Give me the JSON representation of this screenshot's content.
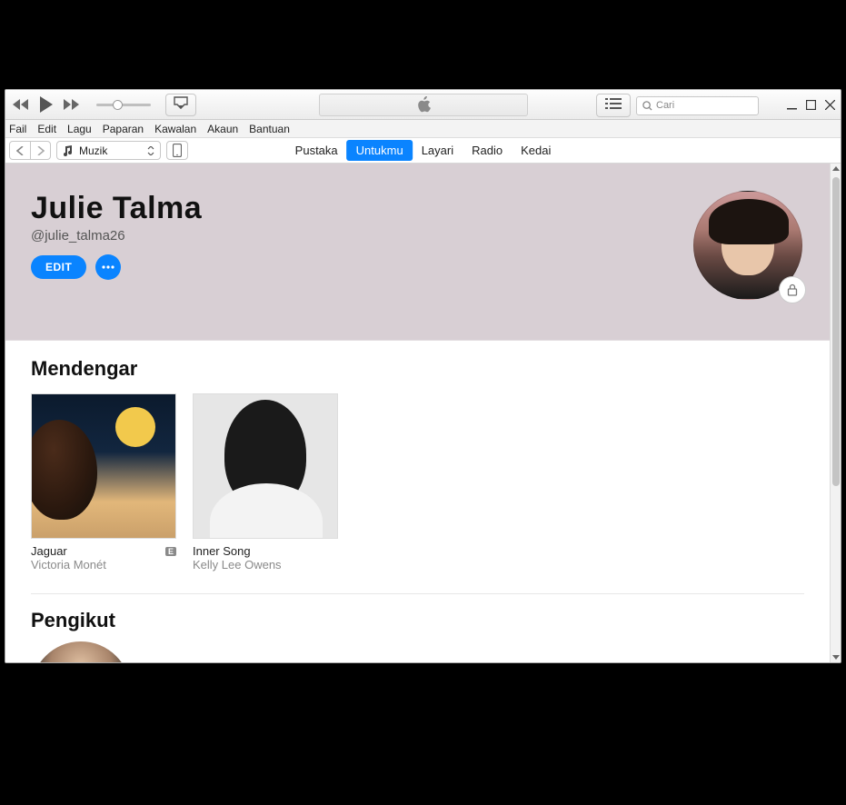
{
  "window": {
    "search_placeholder": "Cari"
  },
  "menu": {
    "items": [
      "Fail",
      "Edit",
      "Lagu",
      "Paparan",
      "Kawalan",
      "Akaun",
      "Bantuan"
    ]
  },
  "media_select": {
    "label": "Muzik"
  },
  "nav": {
    "items": [
      {
        "label": "Pustaka",
        "active": false
      },
      {
        "label": "Untukmu",
        "active": true
      },
      {
        "label": "Layari",
        "active": false
      },
      {
        "label": "Radio",
        "active": false
      },
      {
        "label": "Kedai",
        "active": false
      }
    ]
  },
  "profile": {
    "name": "Julie Talma",
    "handle": "@julie_talma26",
    "edit_label": "EDIT"
  },
  "sections": {
    "listening": {
      "title": "Mendengar",
      "albums": [
        {
          "title": "Jaguar",
          "artist": "Victoria Monét",
          "explicit": "E"
        },
        {
          "title": "Inner Song",
          "artist": "Kelly Lee Owens",
          "explicit": ""
        }
      ]
    },
    "followers": {
      "title": "Pengikut"
    }
  },
  "icons": {
    "apple": "apple",
    "airplay": "airplay",
    "queue": "queue",
    "search": "search",
    "lock": "lock",
    "more": "more"
  }
}
